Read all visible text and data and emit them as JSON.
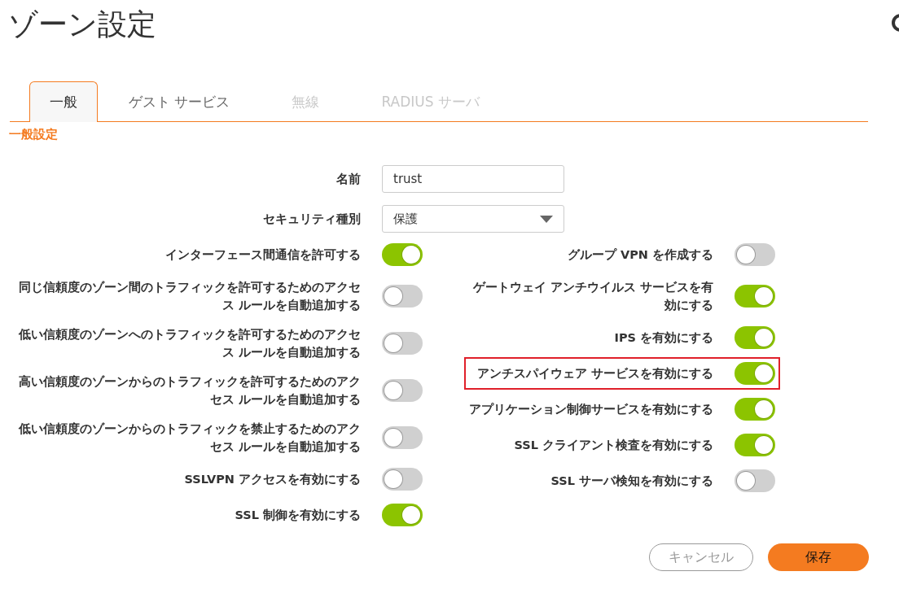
{
  "title": "ゾーン設定",
  "tabs": [
    {
      "label": "一般",
      "selected": true,
      "disabled": false
    },
    {
      "label": "ゲスト サービス",
      "selected": false,
      "disabled": false
    },
    {
      "label": "無線",
      "selected": false,
      "disabled": true
    },
    {
      "label": "RADIUS サーバ",
      "selected": false,
      "disabled": true
    }
  ],
  "section_title": "一般設定",
  "fields": [
    {
      "kind": "text",
      "label": "名前",
      "value": "trust"
    },
    {
      "kind": "select",
      "label": "セキュリティ種別",
      "value": "保護"
    }
  ],
  "left_toggles": [
    {
      "label": "インターフェース間通信を許可する",
      "on": true
    },
    {
      "label": "同じ信頼度のゾーン間のトラフィックを許可するためのアクセス ルールを自動追加する",
      "on": false
    },
    {
      "label": "低い信頼度のゾーンへのトラフィックを許可するためのアクセス ルールを自動追加する",
      "on": false
    },
    {
      "label": "高い信頼度のゾーンからのトラフィックを許可するためのアクセス ルールを自動追加する",
      "on": false
    },
    {
      "label": "低い信頼度のゾーンからのトラフィックを禁止するためのアクセス ルールを自動追加する",
      "on": false
    },
    {
      "label": "SSLVPN アクセスを有効にする",
      "on": false
    },
    {
      "label": "SSL 制御を有効にする",
      "on": true
    }
  ],
  "right_toggles": [
    {
      "label": "グループ VPN を作成する",
      "on": false,
      "highlighted": false
    },
    {
      "label": "ゲートウェイ アンチウイルス サービスを有効にする",
      "on": true,
      "highlighted": false
    },
    {
      "label": "IPS を有効にする",
      "on": true,
      "highlighted": false
    },
    {
      "label": "アンチスパイウェア サービスを有効にする",
      "on": true,
      "highlighted": true
    },
    {
      "label": "アプリケーション制御サービスを有効にする",
      "on": true,
      "highlighted": false
    },
    {
      "label": "SSL クライアント検査を有効にする",
      "on": true,
      "highlighted": false
    },
    {
      "label": "SSL サーバ検知を有効にする",
      "on": false,
      "highlighted": false
    }
  ],
  "buttons": [
    {
      "kind": "secondary",
      "label": "キャンセル"
    },
    {
      "kind": "primary",
      "label": "保存"
    }
  ]
}
